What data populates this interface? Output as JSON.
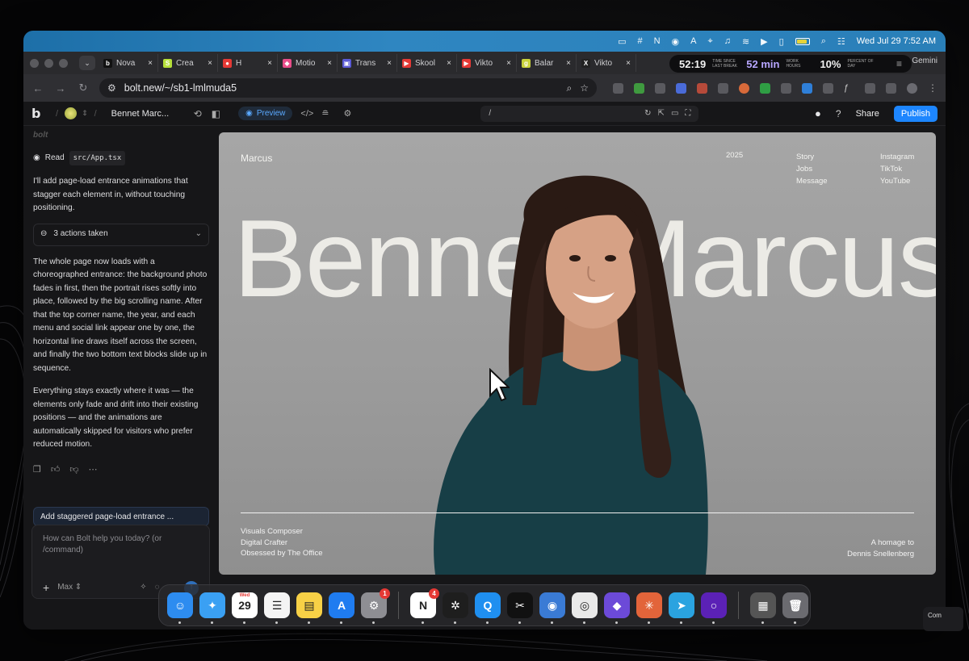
{
  "menubar": {
    "clock": "Wed Jul 29  7:52 AM",
    "colors": {
      "accent": "#2f86c1"
    }
  },
  "tabs": [
    {
      "label": "Nova",
      "favicon": "b",
      "color": "#111111"
    },
    {
      "label": "Crea",
      "favicon": "S",
      "color": "#b6e03a"
    },
    {
      "label": "H",
      "favicon": "●",
      "color": "#e53935"
    },
    {
      "label": "Motio",
      "favicon": "◆",
      "color": "#e94d8a"
    },
    {
      "label": "Trans",
      "favicon": "▣",
      "color": "#5b5bd6"
    },
    {
      "label": "Skool",
      "favicon": "▶",
      "color": "#e53935"
    },
    {
      "label": "Vikto",
      "favicon": "▶",
      "color": "#e53935"
    },
    {
      "label": "Balar",
      "favicon": "g",
      "color": "#c9d23a"
    },
    {
      "label": "Vikto",
      "favicon": "X",
      "color": "#222222"
    }
  ],
  "timer": {
    "time": "52:19",
    "time_caption": "TIME SINCE LAST BREAK",
    "work": "52 min",
    "work_caption": "WORK HOURS",
    "percent": "10%",
    "percent_caption": "PERCENT OF DAY"
  },
  "tab_right": "Gemini",
  "address": {
    "url": "bolt.new/~/sb1-lmlmuda5"
  },
  "bolt": {
    "logo": "b",
    "project": "Bennet Marc...",
    "preview_label": "Preview",
    "path": "/",
    "share": "Share",
    "publish": "Publish"
  },
  "chat": {
    "watermark": "bolt",
    "read_label": "Read",
    "read_file": "src/App.tsx",
    "intro": "I'll add page-load entrance animations that stagger each element in, without touching positioning.",
    "actions": "3 actions taken",
    "para1": "The whole page now loads with a choreographed entrance: the background photo fades in first, then the portrait rises softly into place, followed by the big scrolling name. After that the top corner name, the year, and each menu and social link appear one by one, the horizontal line draws itself across the screen, and finally the two bottom text blocks slide up in sequence.",
    "para2": "Everything stays exactly where it was — the elements only fade and drift into their existing positions — and the animations are automatically skipped for visitors who prefer reduced motion.",
    "suggestion": "Add staggered page-load entrance ...",
    "composer_placeholder": "How can Bolt help you today? (or /command)",
    "model": "Max"
  },
  "preview": {
    "name": "Marcus",
    "year": "2025",
    "menu": [
      "Story",
      "Jobs",
      "Message"
    ],
    "social": [
      "Instagram",
      "TikTok",
      "YouTube"
    ],
    "big_name": "Bennet Marcus",
    "left_lines": [
      "Visuals Composer",
      "Digital Crafter",
      "Obsessed by The Office"
    ],
    "right_lines": [
      "A homage to",
      "Dennis Snellenberg"
    ]
  },
  "dock": {
    "apps": [
      {
        "name": "finder",
        "glyph": "☺",
        "color": "#2d8cf0"
      },
      {
        "name": "safari",
        "glyph": "✦",
        "color": "#3aa0f3"
      },
      {
        "name": "calendar",
        "glyph": "29",
        "color": "#ffffff"
      },
      {
        "name": "reminders",
        "glyph": "☰",
        "color": "#f4f4f4"
      },
      {
        "name": "notes",
        "glyph": "▤",
        "color": "#f7d046"
      },
      {
        "name": "app-store",
        "glyph": "A",
        "color": "#1f7cf0"
      },
      {
        "name": "system-settings",
        "glyph": "⚙",
        "color": "#8e8e93",
        "badge": "1"
      },
      {
        "name": "notion",
        "glyph": "N",
        "color": "#ffffff",
        "badge": "4"
      },
      {
        "name": "figma",
        "glyph": "✲",
        "color": "#1e1e1e"
      },
      {
        "name": "quicktime",
        "glyph": "Q",
        "color": "#1f8ff0"
      },
      {
        "name": "capcut",
        "glyph": "✂",
        "color": "#111111"
      },
      {
        "name": "app-9",
        "glyph": "◉",
        "color": "#3a7bd5"
      },
      {
        "name": "chrome",
        "glyph": "◎",
        "color": "#e9e9e9"
      },
      {
        "name": "obsidian",
        "glyph": "◆",
        "color": "#6c4ad8"
      },
      {
        "name": "claude",
        "glyph": "✳",
        "color": "#e2643a"
      },
      {
        "name": "telegram",
        "glyph": "➤",
        "color": "#2aa3e0"
      },
      {
        "name": "app-15",
        "glyph": "○",
        "color": "#5b21b6"
      },
      {
        "name": "preview",
        "glyph": "▦",
        "color": "#555555"
      },
      {
        "name": "trash",
        "glyph": "🗑",
        "color": "#6b6b70"
      }
    ],
    "calendar_day": "Wed"
  },
  "corner_note": "Com"
}
